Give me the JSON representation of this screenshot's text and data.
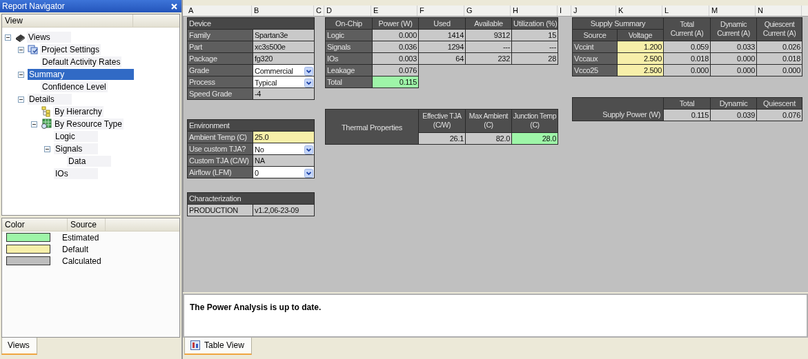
{
  "navigator": {
    "title": "Report Navigator",
    "column": "View",
    "tree": [
      {
        "label": "Views",
        "kind": "chip",
        "expanded": true,
        "selected": false,
        "children": [
          {
            "label": "Project Settings",
            "kind": "settings",
            "expanded": true,
            "selected": false,
            "children": [
              {
                "label": "Default Activity Rates",
                "selected": false
              }
            ]
          },
          {
            "label": "Summary",
            "expanded": true,
            "selected": true,
            "children": [
              {
                "label": "Confidence Level",
                "selected": false
              }
            ]
          },
          {
            "label": "Details",
            "expanded": true,
            "selected": false,
            "children": [
              {
                "label": "By Hierarchy",
                "kind": "hierarchy",
                "selected": false
              },
              {
                "label": "By Resource Type",
                "kind": "resource",
                "expanded": true,
                "selected": false,
                "children": [
                  {
                    "label": "Logic",
                    "selected": false
                  },
                  {
                    "label": "Signals",
                    "expanded": true,
                    "selected": false,
                    "children": [
                      {
                        "label": "Data",
                        "selected": false
                      }
                    ]
                  },
                  {
                    "label": "IOs",
                    "selected": false
                  }
                ]
              }
            ]
          }
        ]
      }
    ]
  },
  "legend": {
    "columns": [
      "Color",
      "Source"
    ],
    "items": [
      {
        "color": "#9ef5a8",
        "label": "Estimated"
      },
      {
        "color": "#f7efa9",
        "label": "Default"
      },
      {
        "color": "#bdbdbd",
        "label": "Calculated"
      }
    ]
  },
  "left_tabs": [
    {
      "label": "Views",
      "selected": true
    }
  ],
  "sheet": {
    "columns": [
      "A",
      "B",
      "C",
      "D",
      "E",
      "F",
      "G",
      "H",
      "I",
      "J",
      "K",
      "L",
      "M",
      "N"
    ],
    "device": {
      "title": "Device",
      "rows": [
        {
          "label": "Family",
          "value": "Spartan3e",
          "kind": "calculated"
        },
        {
          "label": "Part",
          "value": "xc3s500e",
          "kind": "calculated"
        },
        {
          "label": "Package",
          "value": "fg320",
          "kind": "calculated"
        },
        {
          "label": "Grade",
          "value": "Commercial",
          "kind": "dropdown"
        },
        {
          "label": "Process",
          "value": "Typical",
          "kind": "dropdown"
        },
        {
          "label": "Speed Grade",
          "value": "-4",
          "kind": "calculated"
        }
      ]
    },
    "environment": {
      "title": "Environment",
      "rows": [
        {
          "label": "Ambient Temp (C)",
          "value": "25.0",
          "kind": "default"
        },
        {
          "label": "Use custom TJA?",
          "value": "No",
          "kind": "dropdown"
        },
        {
          "label": "Custom TJA (C/W)",
          "value": "NA",
          "kind": "calculated"
        },
        {
          "label": "Airflow (LFM)",
          "value": "0",
          "kind": "dropdown"
        }
      ]
    },
    "characterization": {
      "title": "Characterization",
      "rows": [
        {
          "label": "PRODUCTION",
          "value": "v1.2,06-23-09",
          "kind": "info"
        }
      ]
    },
    "on_chip": {
      "columns": [
        "On-Chip",
        "Power (W)",
        "Used",
        "Available",
        "Utilization (%)"
      ],
      "rows": [
        {
          "cells": [
            {
              "text": "Logic",
              "kind": "label"
            },
            {
              "text": "0.000",
              "kind": "calculated"
            },
            {
              "text": "1414",
              "kind": "calculated"
            },
            {
              "text": "9312",
              "kind": "calculated"
            },
            {
              "text": "15",
              "kind": "calculated"
            }
          ]
        },
        {
          "cells": [
            {
              "text": "Signals",
              "kind": "label"
            },
            {
              "text": "0.036",
              "kind": "calculated"
            },
            {
              "text": "1294",
              "kind": "calculated"
            },
            {
              "text": "---",
              "kind": "calculated"
            },
            {
              "text": "---",
              "kind": "calculated"
            }
          ]
        },
        {
          "cells": [
            {
              "text": "IOs",
              "kind": "label"
            },
            {
              "text": "0.003",
              "kind": "calculated"
            },
            {
              "text": "64",
              "kind": "calculated"
            },
            {
              "text": "232",
              "kind": "calculated"
            },
            {
              "text": "28",
              "kind": "calculated"
            }
          ]
        },
        {
          "cells": [
            {
              "text": "Leakage",
              "kind": "label"
            },
            {
              "text": "0.076",
              "kind": "calculated"
            }
          ]
        },
        {
          "cells": [
            {
              "text": "Total",
              "kind": "label"
            },
            {
              "text": "0.115",
              "kind": "estimated"
            }
          ]
        }
      ]
    },
    "thermal": {
      "title": "Thermal Properties",
      "columns": [
        "Effective TJA (C/W)",
        "Max Ambient (C)",
        "Junction Temp (C)"
      ],
      "values": [
        {
          "text": "26.1",
          "kind": "calculated"
        },
        {
          "text": "82.0",
          "kind": "calculated"
        },
        {
          "text": "28.0",
          "kind": "estimated"
        }
      ]
    },
    "supply_summary": {
      "title": "Supply Summary",
      "columns": [
        "Source",
        "Voltage",
        "Total Current (A)",
        "Dynamic Current (A)",
        "Quiescent Current (A)"
      ],
      "rows": [
        {
          "cells": [
            {
              "text": "Vccint",
              "kind": "label"
            },
            {
              "text": "1.200",
              "kind": "default"
            },
            {
              "text": "0.059",
              "kind": "calculated"
            },
            {
              "text": "0.033",
              "kind": "calculated"
            },
            {
              "text": "0.026",
              "kind": "calculated"
            }
          ]
        },
        {
          "cells": [
            {
              "text": "Vccaux",
              "kind": "label"
            },
            {
              "text": "2.500",
              "kind": "default"
            },
            {
              "text": "0.018",
              "kind": "calculated"
            },
            {
              "text": "0.000",
              "kind": "calculated"
            },
            {
              "text": "0.018",
              "kind": "calculated"
            }
          ]
        },
        {
          "cells": [
            {
              "text": "Vcco25",
              "kind": "label"
            },
            {
              "text": "2.500",
              "kind": "default"
            },
            {
              "text": "0.000",
              "kind": "calculated"
            },
            {
              "text": "0.000",
              "kind": "calculated"
            },
            {
              "text": "0.000",
              "kind": "calculated"
            }
          ]
        }
      ]
    },
    "supply_power": {
      "label": "Supply Power (W)",
      "columns": [
        "Total",
        "Dynamic",
        "Quiescent"
      ],
      "values": [
        {
          "text": "0.115",
          "kind": "calculated"
        },
        {
          "text": "0.039",
          "kind": "calculated"
        },
        {
          "text": "0.076",
          "kind": "calculated"
        }
      ]
    }
  },
  "message": "The Power Analysis is up to date.",
  "bottom_tabs": [
    {
      "label": "Table View",
      "selected": true
    }
  ]
}
